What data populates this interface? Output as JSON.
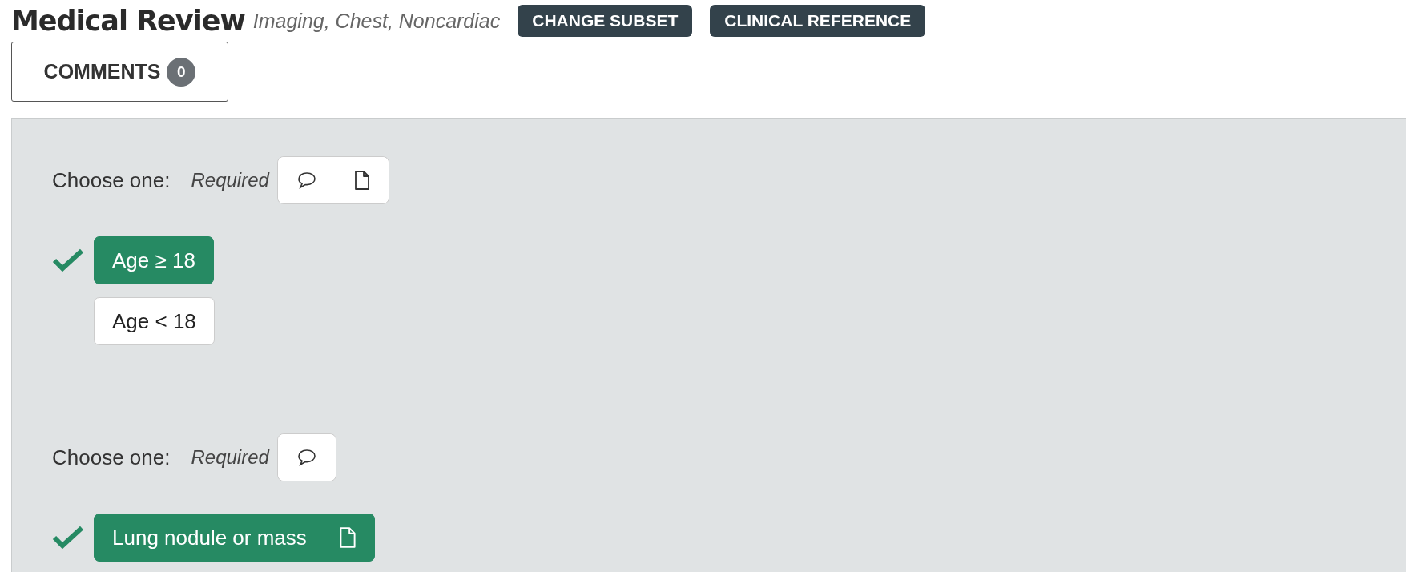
{
  "header": {
    "title": "Medical Review",
    "subtitle": "Imaging, Chest, Noncardiac",
    "buttons": [
      "CHANGE SUBSET",
      "CLINICAL REFERENCE"
    ]
  },
  "comments": {
    "label": "COMMENTS",
    "count": "0"
  },
  "questions": [
    {
      "prompt": "Choose one:",
      "required": "Required",
      "tools": [
        {
          "kind": "comment"
        },
        {
          "kind": "file"
        }
      ],
      "options": [
        {
          "label": "Age ≥ 18",
          "selected": true,
          "has_file": false
        },
        {
          "label": "Age < 18",
          "selected": false,
          "has_file": false
        }
      ]
    },
    {
      "prompt": "Choose one:",
      "required": "Required",
      "tools": [
        {
          "kind": "comment"
        }
      ],
      "options": [
        {
          "label": "Lung nodule or mass",
          "selected": true,
          "has_file": true
        }
      ]
    }
  ]
}
